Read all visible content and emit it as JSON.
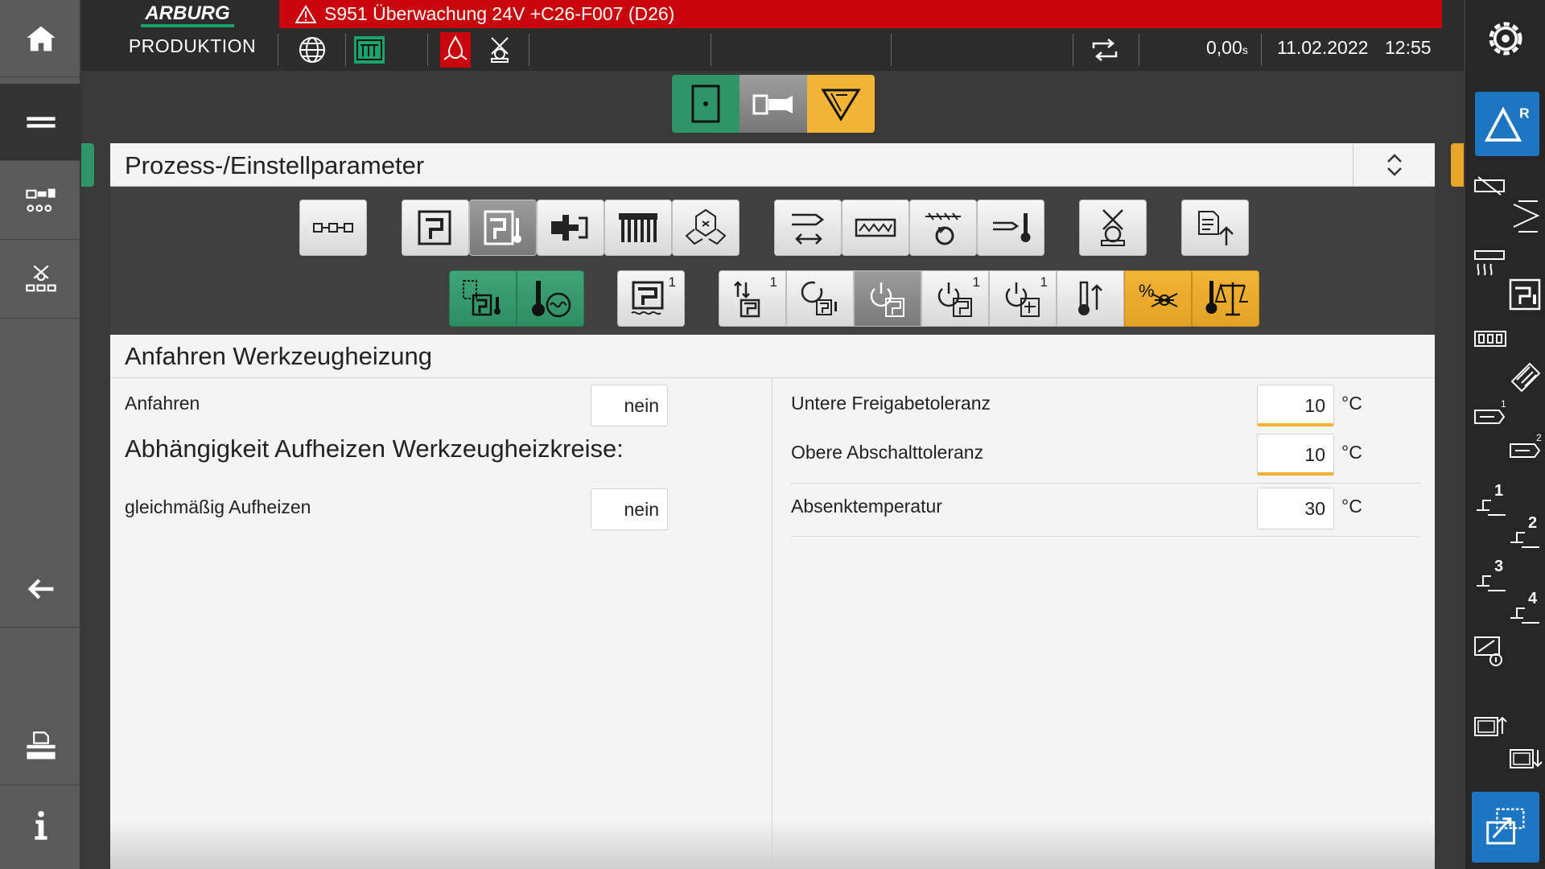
{
  "header": {
    "logo_text": "ARBURG",
    "mode": "PRODUKTION",
    "alarm_text": "S951 Überwachung 24V +C26-F007 (D26)",
    "cycle_time": "0,00",
    "cycle_time_unit": "s",
    "date": "11.02.2022",
    "time": "12:55"
  },
  "left_sidebar": [
    "home-icon",
    "menu-icon",
    "machine-overview-icon",
    "robot-overview-icon",
    "back-arrow-icon",
    "print-icon",
    "info-icon"
  ],
  "process_panel": {
    "title": "Prozess-/Einstellparameter"
  },
  "parameter_tab_indices": {
    "mould_heating_1": "1",
    "heat_up_1": "1",
    "switch_off_1": "1",
    "switch_off_2": "1"
  },
  "content": {
    "title": "Anfahren Werkzeugheizung",
    "left": {
      "anfahren_label": "Anfahren",
      "anfahren_value": "nein",
      "dependency_heading": "Abhängigkeit Aufheizen Werkzeugheizkreise:",
      "gleichmaessig_label": "gleichmäßig Aufheizen",
      "gleichmaessig_value": "nein"
    },
    "right": {
      "rows": [
        {
          "label": "Untere Freigabetoleranz",
          "value": "10",
          "unit": "°C"
        },
        {
          "label": "Obere Abschalttoleranz",
          "value": "10",
          "unit": "°C"
        },
        {
          "label": "Absenktemperatur",
          "value": "30",
          "unit": "°C"
        }
      ]
    }
  },
  "right_sidebar": {
    "r_badge": "R",
    "index_labels": [
      "1",
      "2",
      "1",
      "2",
      "3",
      "4"
    ]
  },
  "colors": {
    "alarm_red": "#c9060b",
    "accent_green": "#3fa476",
    "accent_yellow": "#f1b435",
    "accent_blue": "#1d76c2"
  }
}
